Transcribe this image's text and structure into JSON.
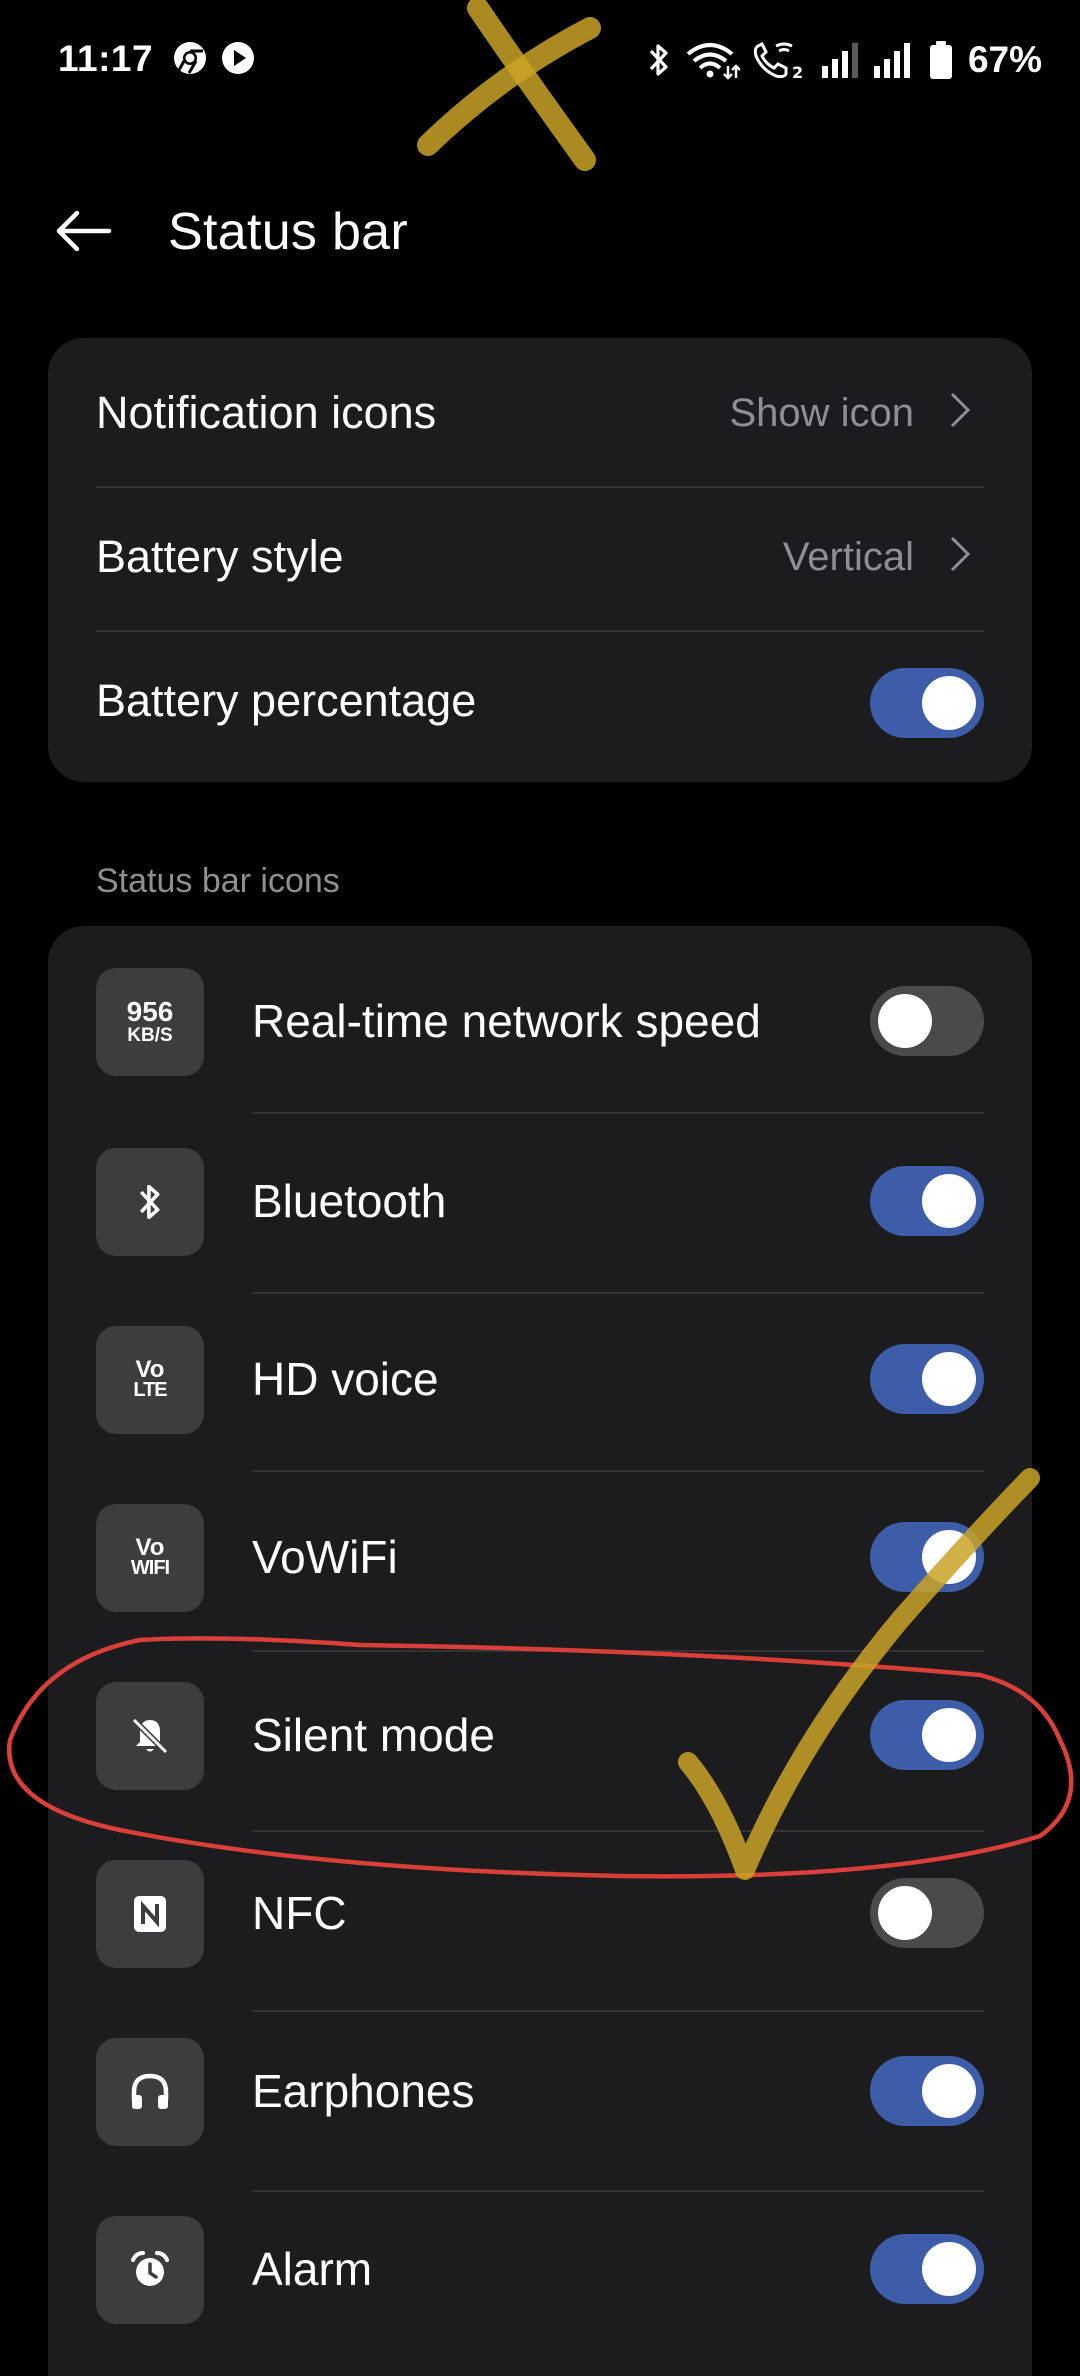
{
  "status_bar": {
    "time": "11:17",
    "battery_pct": "67%",
    "left_icons": [
      "chrome-icon",
      "play-icon"
    ],
    "right_icons": [
      "bluetooth-icon",
      "wifi-icon",
      "wifi-call-icon",
      "signal-icon",
      "signal-icon",
      "battery-icon"
    ]
  },
  "header": {
    "title": "Status bar"
  },
  "general": {
    "rows": [
      {
        "label": "Notification icons",
        "value": "Show icon",
        "type": "nav"
      },
      {
        "label": "Battery style",
        "value": "Vertical",
        "type": "nav"
      },
      {
        "label": "Battery percentage",
        "type": "toggle",
        "on": true
      }
    ]
  },
  "icons_section": {
    "header": "Status bar icons",
    "items": [
      {
        "label": "Real-time network speed",
        "icon": "network-speed-icon",
        "icon_text_top": "956",
        "icon_text_bottom": "KB/S",
        "on": false
      },
      {
        "label": "Bluetooth",
        "icon": "bluetooth-icon",
        "on": true
      },
      {
        "label": "HD voice",
        "icon": "volte-icon",
        "icon_text_top": "Vo",
        "icon_text_bottom": "LTE",
        "on": true
      },
      {
        "label": "VoWiFi",
        "icon": "vowifi-icon",
        "icon_text_top": "Vo",
        "icon_text_bottom": "WIFI",
        "on": true
      },
      {
        "label": "Silent mode",
        "icon": "bell-off-icon",
        "on": true
      },
      {
        "label": "NFC",
        "icon": "nfc-icon",
        "on": false
      },
      {
        "label": "Earphones",
        "icon": "headphones-icon",
        "on": true
      },
      {
        "label": "Alarm",
        "icon": "alarm-icon",
        "on": true
      }
    ]
  },
  "colors": {
    "toggle_on": "#3d5da8",
    "toggle_off": "#4a4a4c",
    "card_bg": "#1c1c1e",
    "annotation_red": "#d9403a",
    "annotation_yellow": "#c9a227"
  }
}
